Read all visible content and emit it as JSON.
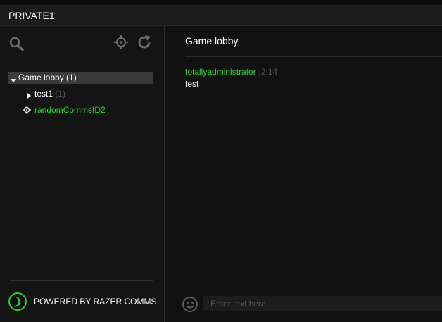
{
  "window": {
    "title": "PRIVATE1"
  },
  "sidebar": {
    "tree": {
      "channel": {
        "label": "Game lobby (1)",
        "expanded": true
      },
      "subchannel": {
        "label": "test1",
        "count": "(1)",
        "expanded": false
      },
      "user": {
        "label": "randomCommsID2"
      }
    },
    "footer": {
      "powered_by": "POWERED BY RAZER COMMS"
    }
  },
  "chat": {
    "channel_title": "Game lobby",
    "messages": [
      {
        "author": "totallyadministrator",
        "time": "|2:14",
        "text": "test"
      }
    ],
    "input": {
      "value": "",
      "placeholder": "Enter text here"
    }
  },
  "icons": {
    "search": "search-icon",
    "target": "crosshair-icon",
    "refresh": "refresh-icon",
    "emoji": "smiley-icon",
    "logo": "razer-logo-icon"
  },
  "colors": {
    "accent_green": "#22dd22",
    "background": "#111111",
    "selected_row": "#3a3a3a"
  }
}
